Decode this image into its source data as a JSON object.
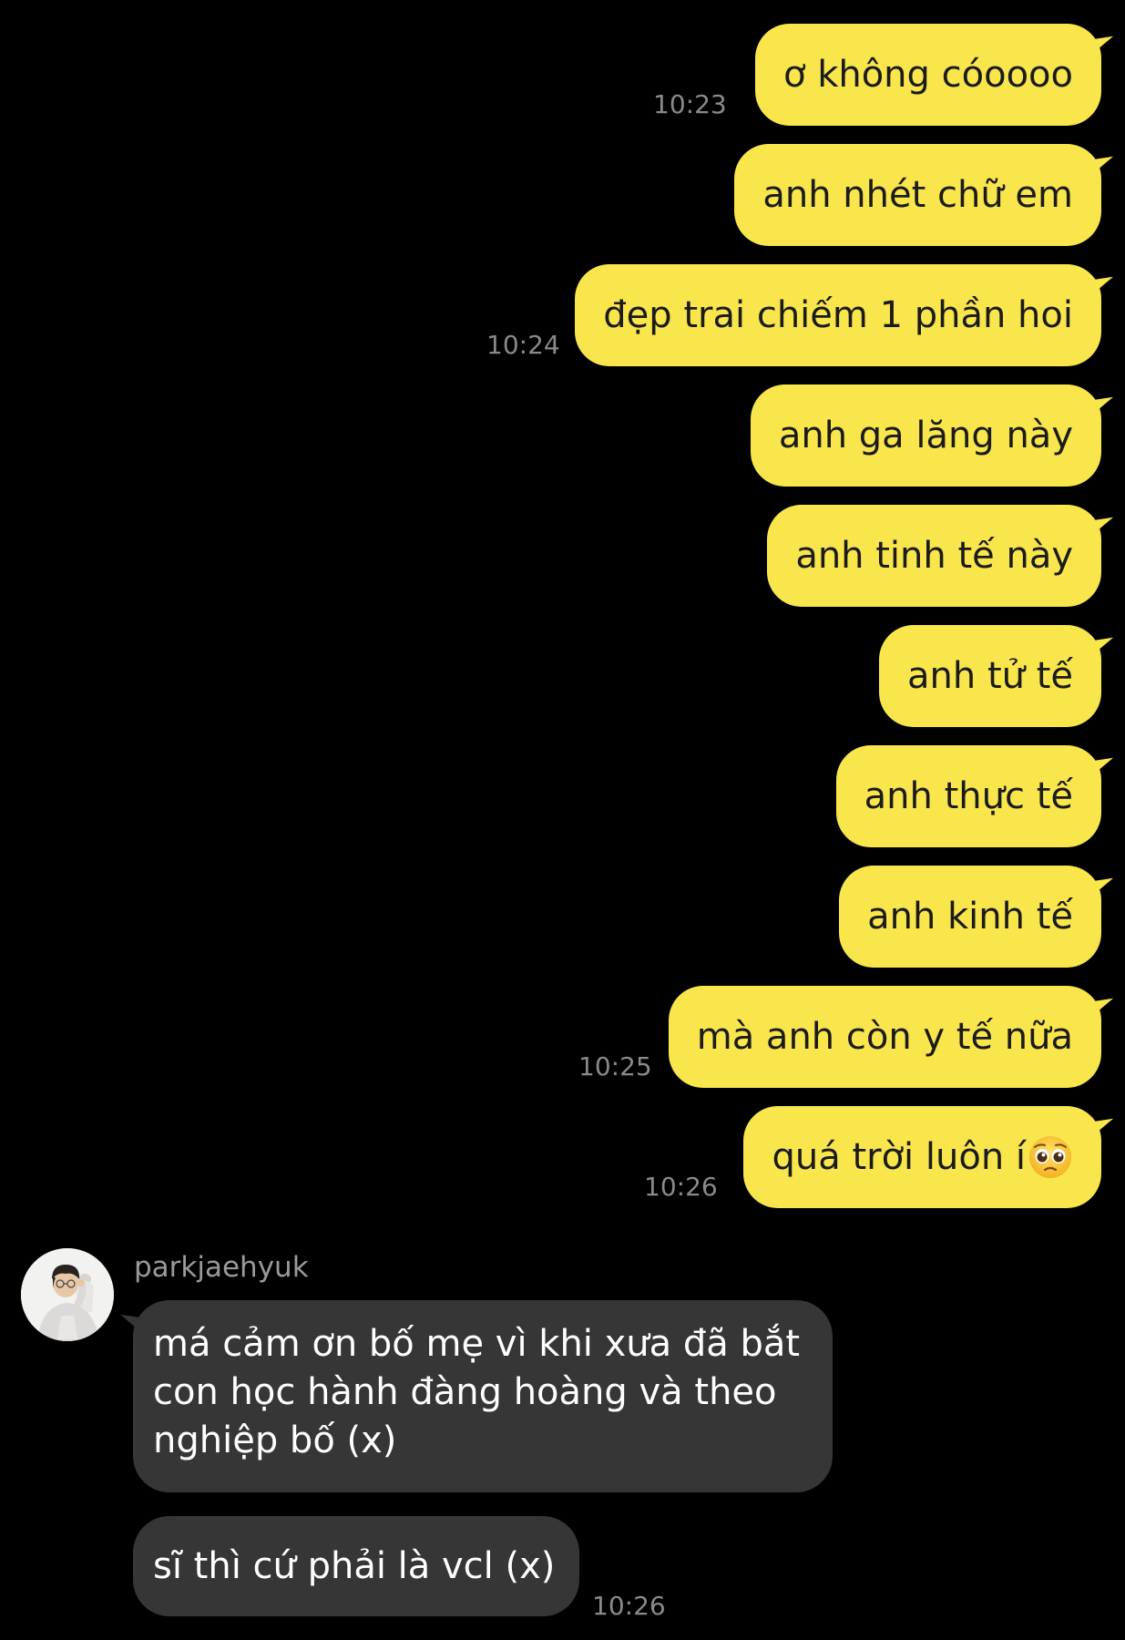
{
  "colors": {
    "background": "#000000",
    "sent_bubble": "#f9e54c",
    "received_bubble": "#363636",
    "timestamp": "#8a8a8a"
  },
  "sent_messages": [
    {
      "text": "ơ không cóoooo",
      "time": "10:23"
    },
    {
      "text": "anh nhét chữ em",
      "time": ""
    },
    {
      "text": "đẹp trai chiếm 1 phần hoi",
      "time": "10:24"
    },
    {
      "text": "anh ga lăng này",
      "time": ""
    },
    {
      "text": "anh tinh tế này",
      "time": ""
    },
    {
      "text": "anh tử tế",
      "time": ""
    },
    {
      "text": "anh thực tế",
      "time": ""
    },
    {
      "text": "anh kinh tế",
      "time": ""
    },
    {
      "text": "mà anh còn y tế nữa",
      "time": "10:25"
    },
    {
      "text": "quá trời luôn í",
      "time": "10:26",
      "emoji": "pleading-face-emoji"
    }
  ],
  "received": {
    "sender": "parkjaehyuk",
    "avatar_icon": "profile-photo-avatar",
    "messages": [
      {
        "text": "má cảm ơn bố mẹ vì khi xưa đã bắt con học hành đàng hoàng và theo nghiệp bố (x)"
      },
      {
        "text": "sĩ thì cứ phải là vcl (x)",
        "time": "10:26"
      }
    ]
  }
}
